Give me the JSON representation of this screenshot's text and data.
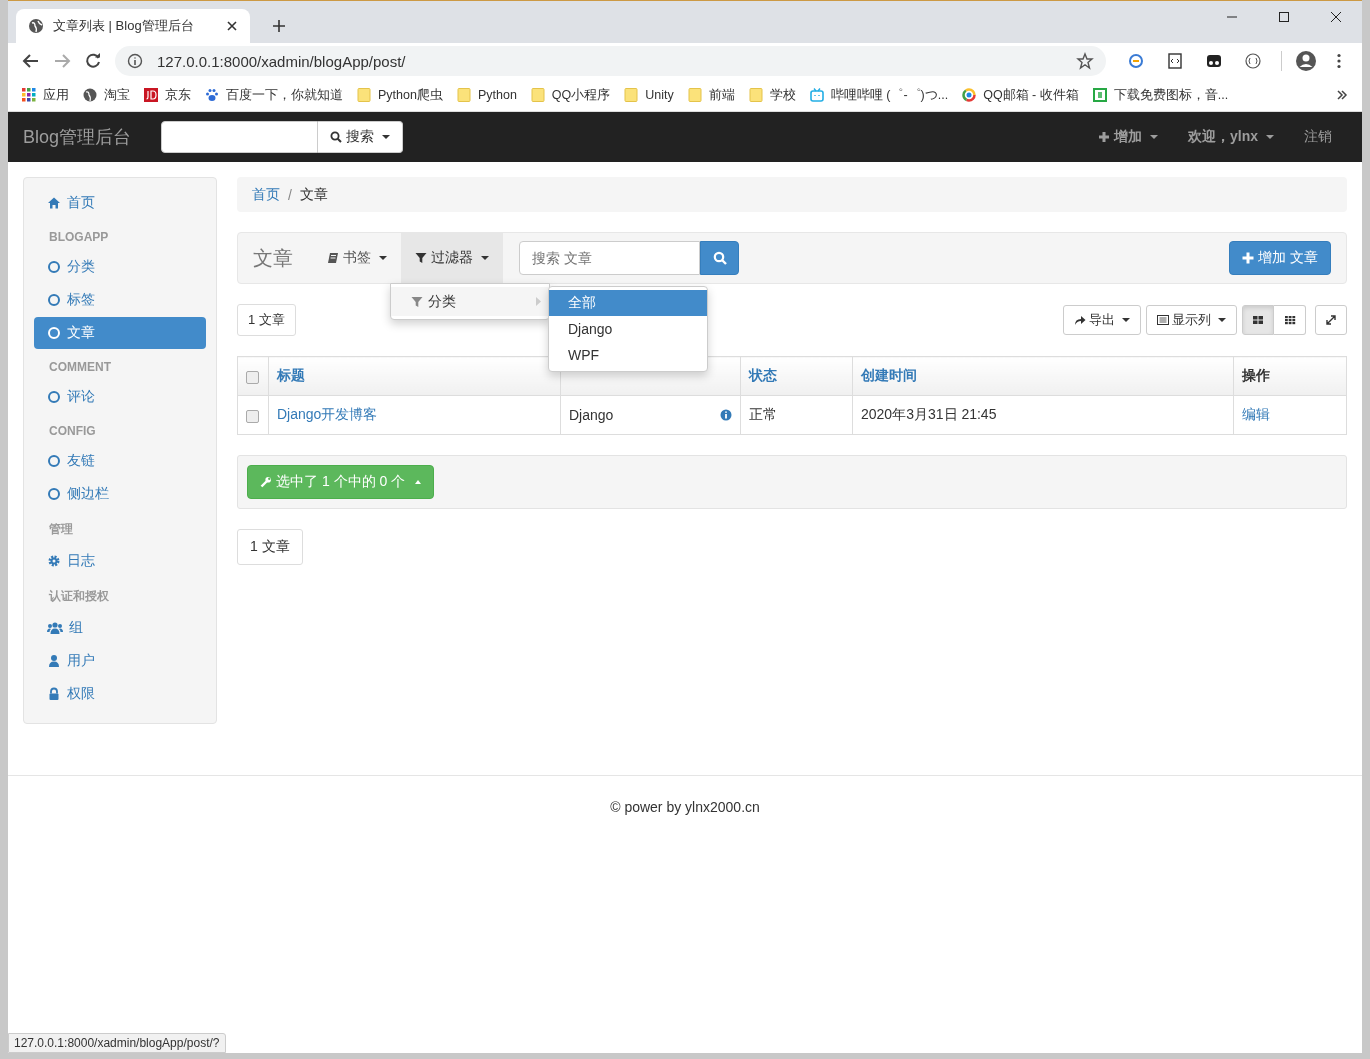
{
  "browser": {
    "tab_title": "文章列表 | Blog管理后台",
    "url": "127.0.0.1:8000/xadmin/blogApp/post/",
    "bookmarks": [
      {
        "label": "应用"
      },
      {
        "label": "淘宝"
      },
      {
        "label": "京东"
      },
      {
        "label": "百度一下，你就知道"
      },
      {
        "label": "Python爬虫"
      },
      {
        "label": "Python"
      },
      {
        "label": "QQ小程序"
      },
      {
        "label": "Unity"
      },
      {
        "label": "前端"
      },
      {
        "label": "学校"
      },
      {
        "label": "哔哩哔哩 (゜-゜)つ..."
      },
      {
        "label": "QQ邮箱 - 收件箱"
      },
      {
        "label": "下载免费图标，音..."
      }
    ],
    "status_url": "127.0.0.1:8000/xadmin/blogApp/post/?"
  },
  "navbar": {
    "brand": "Blog管理后台",
    "search_button": "搜索",
    "add_menu": "增加",
    "user_menu": "欢迎，ylnx",
    "logout": "注销"
  },
  "sidebar": {
    "items": [
      {
        "kind": "link",
        "label": "首页",
        "selected": false
      },
      {
        "kind": "section",
        "label": "BLOGAPP"
      },
      {
        "kind": "link",
        "label": "分类",
        "selected": false
      },
      {
        "kind": "link",
        "label": "标签",
        "selected": false
      },
      {
        "kind": "link",
        "label": "文章",
        "selected": true
      },
      {
        "kind": "section",
        "label": "COMMENT"
      },
      {
        "kind": "link",
        "label": "评论",
        "selected": false
      },
      {
        "kind": "section",
        "label": "CONFIG"
      },
      {
        "kind": "link",
        "label": "友链",
        "selected": false
      },
      {
        "kind": "link",
        "label": "侧边栏",
        "selected": false
      },
      {
        "kind": "section",
        "label": "管理"
      },
      {
        "kind": "link",
        "label": "日志",
        "selected": false
      },
      {
        "kind": "section",
        "label": "认证和授权"
      },
      {
        "kind": "link",
        "label": "组",
        "selected": false
      },
      {
        "kind": "link",
        "label": "用户",
        "selected": false
      },
      {
        "kind": "link",
        "label": "权限",
        "selected": false
      }
    ]
  },
  "breadcrumb": {
    "separator": "/",
    "items": [
      "首页",
      "文章"
    ]
  },
  "toolbar": {
    "title": "文章",
    "bookmarks_button": "书签",
    "filter_button": "过滤器",
    "search": {
      "placeholder": "搜索 文章"
    },
    "add_button": "增加 文章"
  },
  "filter_menu": {
    "items": [
      {
        "label": "分类"
      }
    ],
    "submenu": [
      {
        "label": "全部",
        "selected": true
      },
      {
        "label": "Django",
        "selected": false
      },
      {
        "label": "WPF",
        "selected": false
      }
    ]
  },
  "count_label": "1 文章",
  "view_buttons": {
    "export": "导出",
    "columns": "显示列",
    "layouts": [
      {
        "selected": true
      },
      {
        "selected": false
      }
    ]
  },
  "table": {
    "all_checked": false,
    "columns": [
      {
        "label": "标题",
        "kind": "link"
      },
      {},
      {
        "label": "状态",
        "kind": "link"
      },
      {
        "label": "创建时间",
        "kind": "link"
      },
      {
        "label": "操作",
        "kind": "plain"
      }
    ],
    "rows": [
      {
        "checked": false,
        "cells": [
          "Django开发博客",
          "Django",
          "正常",
          "2020年3月31日 21:45",
          "编辑"
        ]
      }
    ]
  },
  "actions_button": "选中了 1 个中的 0 个",
  "pagination": "1 文章",
  "footer": "© power by ylnx2000.cn"
}
